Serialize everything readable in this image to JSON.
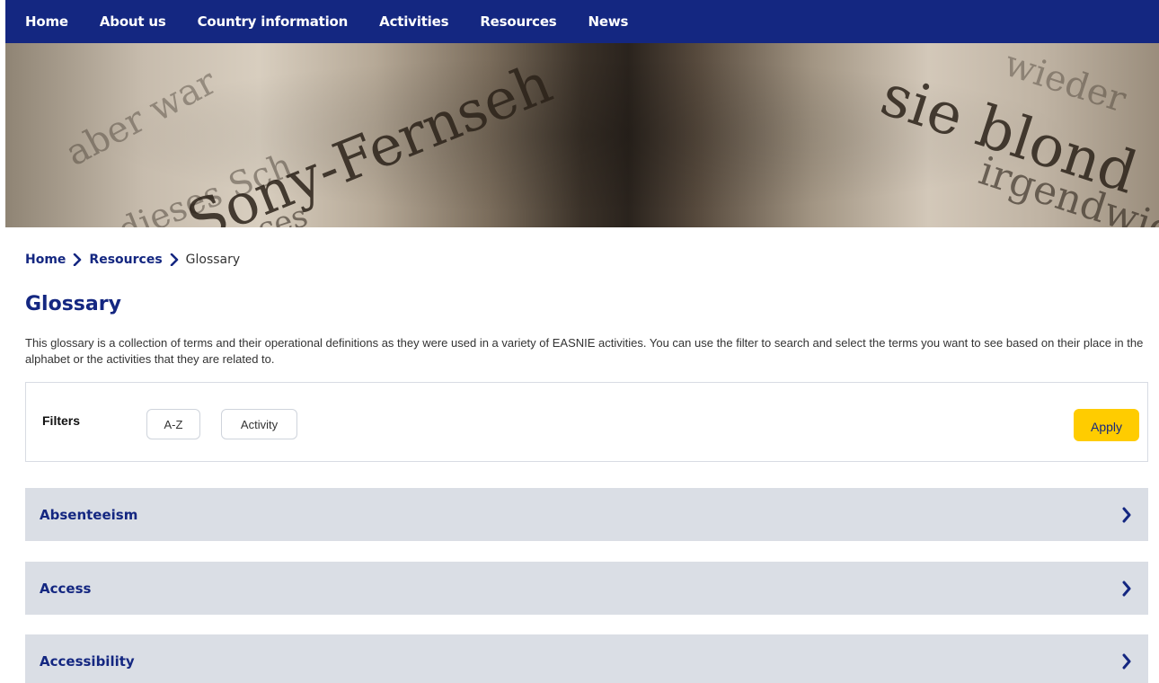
{
  "nav": {
    "items": [
      {
        "label": "Home"
      },
      {
        "label": "About us"
      },
      {
        "label": "Country information"
      },
      {
        "label": "Activities"
      },
      {
        "label": "Resources"
      },
      {
        "label": "News"
      }
    ]
  },
  "hero": {
    "words": [
      "Sony-Fernseh",
      "aber war",
      "dieses Sch",
      "sie blond",
      "wieder",
      "irgendwie",
      "ces"
    ]
  },
  "breadcrumb": {
    "home": "Home",
    "resources": "Resources",
    "current": "Glossary",
    "separator_icon": "chevron-right-icon"
  },
  "page": {
    "title": "Glossary",
    "intro": "This glossary is a collection of terms and their operational definitions as they were used in a variety of EASNIE activities. You can use the filter to search and select the terms you want to see based on their place in the alphabet or the activities that they are related to."
  },
  "filters": {
    "label": "Filters",
    "az_label": "A-Z",
    "activity_label": "Activity",
    "apply_label": "Apply"
  },
  "glossary": {
    "items": [
      {
        "label": "Absenteeism"
      },
      {
        "label": "Access"
      },
      {
        "label": "Accessibility"
      }
    ],
    "chevron_icon": "chevron-right-icon"
  },
  "colors": {
    "brand_navy": "#142781",
    "accent_yellow": "#ffcc00",
    "row_background": "#dadee5"
  }
}
